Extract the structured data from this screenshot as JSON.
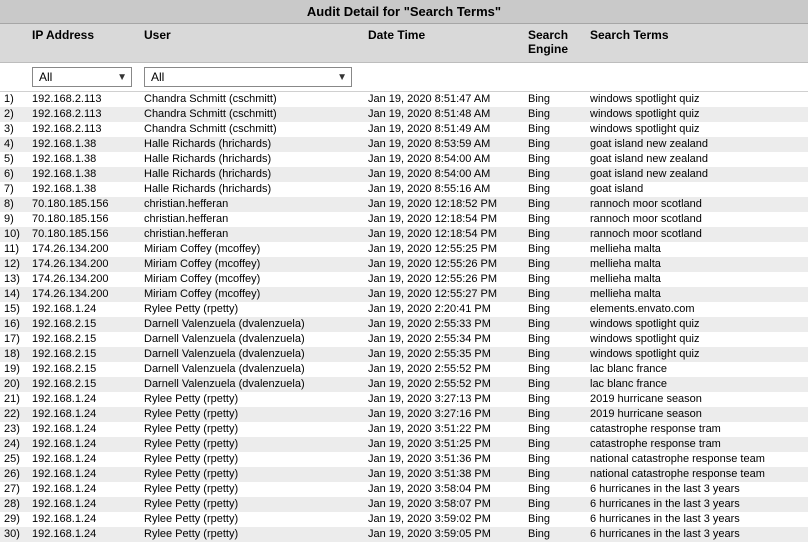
{
  "title": "Audit Detail for \"Search Terms\"",
  "columns": {
    "ip": "IP Address",
    "user": "User",
    "datetime": "Date Time",
    "engine_line1": "Search",
    "engine_line2": "Engine",
    "terms": "Search Terms"
  },
  "filters": {
    "ip_value": "All",
    "user_value": "All"
  },
  "rows": [
    {
      "n": "1)",
      "ip": "192.168.2.113",
      "user": "Chandra Schmitt (cschmitt)",
      "dt": "Jan 19, 2020 8:51:47 AM",
      "eng": "Bing",
      "terms": "windows spotlight quiz"
    },
    {
      "n": "2)",
      "ip": "192.168.2.113",
      "user": "Chandra Schmitt (cschmitt)",
      "dt": "Jan 19, 2020 8:51:48 AM",
      "eng": "Bing",
      "terms": "windows spotlight quiz"
    },
    {
      "n": "3)",
      "ip": "192.168.2.113",
      "user": "Chandra Schmitt (cschmitt)",
      "dt": "Jan 19, 2020 8:51:49 AM",
      "eng": "Bing",
      "terms": "windows spotlight quiz"
    },
    {
      "n": "4)",
      "ip": "192.168.1.38",
      "user": "Halle Richards (hrichards)",
      "dt": "Jan 19, 2020 8:53:59 AM",
      "eng": "Bing",
      "terms": "goat island new zealand"
    },
    {
      "n": "5)",
      "ip": "192.168.1.38",
      "user": "Halle Richards (hrichards)",
      "dt": "Jan 19, 2020 8:54:00 AM",
      "eng": "Bing",
      "terms": "goat island new zealand"
    },
    {
      "n": "6)",
      "ip": "192.168.1.38",
      "user": "Halle Richards (hrichards)",
      "dt": "Jan 19, 2020 8:54:00 AM",
      "eng": "Bing",
      "terms": "goat island new zealand"
    },
    {
      "n": "7)",
      "ip": "192.168.1.38",
      "user": "Halle Richards (hrichards)",
      "dt": "Jan 19, 2020 8:55:16 AM",
      "eng": "Bing",
      "terms": "goat island"
    },
    {
      "n": "8)",
      "ip": "70.180.185.156",
      "user": "christian.hefferan",
      "dt": "Jan 19, 2020 12:18:52 PM",
      "eng": "Bing",
      "terms": "rannoch moor scotland"
    },
    {
      "n": "9)",
      "ip": "70.180.185.156",
      "user": "christian.hefferan",
      "dt": "Jan 19, 2020 12:18:54 PM",
      "eng": "Bing",
      "terms": "rannoch moor scotland"
    },
    {
      "n": "10)",
      "ip": "70.180.185.156",
      "user": "christian.hefferan",
      "dt": "Jan 19, 2020 12:18:54 PM",
      "eng": "Bing",
      "terms": "rannoch moor scotland"
    },
    {
      "n": "11)",
      "ip": "174.26.134.200",
      "user": "Miriam Coffey (mcoffey)",
      "dt": "Jan 19, 2020 12:55:25 PM",
      "eng": "Bing",
      "terms": "mellieha malta"
    },
    {
      "n": "12)",
      "ip": "174.26.134.200",
      "user": "Miriam Coffey (mcoffey)",
      "dt": "Jan 19, 2020 12:55:26 PM",
      "eng": "Bing",
      "terms": "mellieha malta"
    },
    {
      "n": "13)",
      "ip": "174.26.134.200",
      "user": "Miriam Coffey (mcoffey)",
      "dt": "Jan 19, 2020 12:55:26 PM",
      "eng": "Bing",
      "terms": "mellieha malta"
    },
    {
      "n": "14)",
      "ip": "174.26.134.200",
      "user": "Miriam Coffey (mcoffey)",
      "dt": "Jan 19, 2020 12:55:27 PM",
      "eng": "Bing",
      "terms": "mellieha malta"
    },
    {
      "n": "15)",
      "ip": "192.168.1.24",
      "user": "Rylee Petty (rpetty)",
      "dt": "Jan 19, 2020 2:20:41 PM",
      "eng": "Bing",
      "terms": "elements.envato.com"
    },
    {
      "n": "16)",
      "ip": "192.168.2.15",
      "user": "Darnell Valenzuela (dvalenzuela)",
      "dt": "Jan 19, 2020 2:55:33 PM",
      "eng": "Bing",
      "terms": "windows spotlight quiz"
    },
    {
      "n": "17)",
      "ip": "192.168.2.15",
      "user": "Darnell Valenzuela (dvalenzuela)",
      "dt": "Jan 19, 2020 2:55:34 PM",
      "eng": "Bing",
      "terms": "windows spotlight quiz"
    },
    {
      "n": "18)",
      "ip": "192.168.2.15",
      "user": "Darnell Valenzuela (dvalenzuela)",
      "dt": "Jan 19, 2020 2:55:35 PM",
      "eng": "Bing",
      "terms": "windows spotlight quiz"
    },
    {
      "n": "19)",
      "ip": "192.168.2.15",
      "user": "Darnell Valenzuela (dvalenzuela)",
      "dt": "Jan 19, 2020 2:55:52 PM",
      "eng": "Bing",
      "terms": "lac blanc france"
    },
    {
      "n": "20)",
      "ip": "192.168.2.15",
      "user": "Darnell Valenzuela (dvalenzuela)",
      "dt": "Jan 19, 2020 2:55:52 PM",
      "eng": "Bing",
      "terms": "lac blanc france"
    },
    {
      "n": "21)",
      "ip": "192.168.1.24",
      "user": "Rylee Petty (rpetty)",
      "dt": "Jan 19, 2020 3:27:13 PM",
      "eng": "Bing",
      "terms": "2019 hurricane season"
    },
    {
      "n": "22)",
      "ip": "192.168.1.24",
      "user": "Rylee Petty (rpetty)",
      "dt": "Jan 19, 2020 3:27:16 PM",
      "eng": "Bing",
      "terms": "2019 hurricane season"
    },
    {
      "n": "23)",
      "ip": "192.168.1.24",
      "user": "Rylee Petty (rpetty)",
      "dt": "Jan 19, 2020 3:51:22 PM",
      "eng": "Bing",
      "terms": "catastrophe response tram"
    },
    {
      "n": "24)",
      "ip": "192.168.1.24",
      "user": "Rylee Petty (rpetty)",
      "dt": "Jan 19, 2020 3:51:25 PM",
      "eng": "Bing",
      "terms": "catastrophe response tram"
    },
    {
      "n": "25)",
      "ip": "192.168.1.24",
      "user": "Rylee Petty (rpetty)",
      "dt": "Jan 19, 2020 3:51:36 PM",
      "eng": "Bing",
      "terms": "national catastrophe response team"
    },
    {
      "n": "26)",
      "ip": "192.168.1.24",
      "user": "Rylee Petty (rpetty)",
      "dt": "Jan 19, 2020 3:51:38 PM",
      "eng": "Bing",
      "terms": "national catastrophe response team"
    },
    {
      "n": "27)",
      "ip": "192.168.1.24",
      "user": "Rylee Petty (rpetty)",
      "dt": "Jan 19, 2020 3:58:04 PM",
      "eng": "Bing",
      "terms": "6 hurricanes in the last 3 years"
    },
    {
      "n": "28)",
      "ip": "192.168.1.24",
      "user": "Rylee Petty (rpetty)",
      "dt": "Jan 19, 2020 3:58:07 PM",
      "eng": "Bing",
      "terms": "6 hurricanes in the last 3 years"
    },
    {
      "n": "29)",
      "ip": "192.168.1.24",
      "user": "Rylee Petty (rpetty)",
      "dt": "Jan 19, 2020 3:59:02 PM",
      "eng": "Bing",
      "terms": "6 hurricanes in the last 3 years"
    },
    {
      "n": "30)",
      "ip": "192.168.1.24",
      "user": "Rylee Petty (rpetty)",
      "dt": "Jan 19, 2020 3:59:05 PM",
      "eng": "Bing",
      "terms": "6 hurricanes in the last 3 years"
    }
  ]
}
